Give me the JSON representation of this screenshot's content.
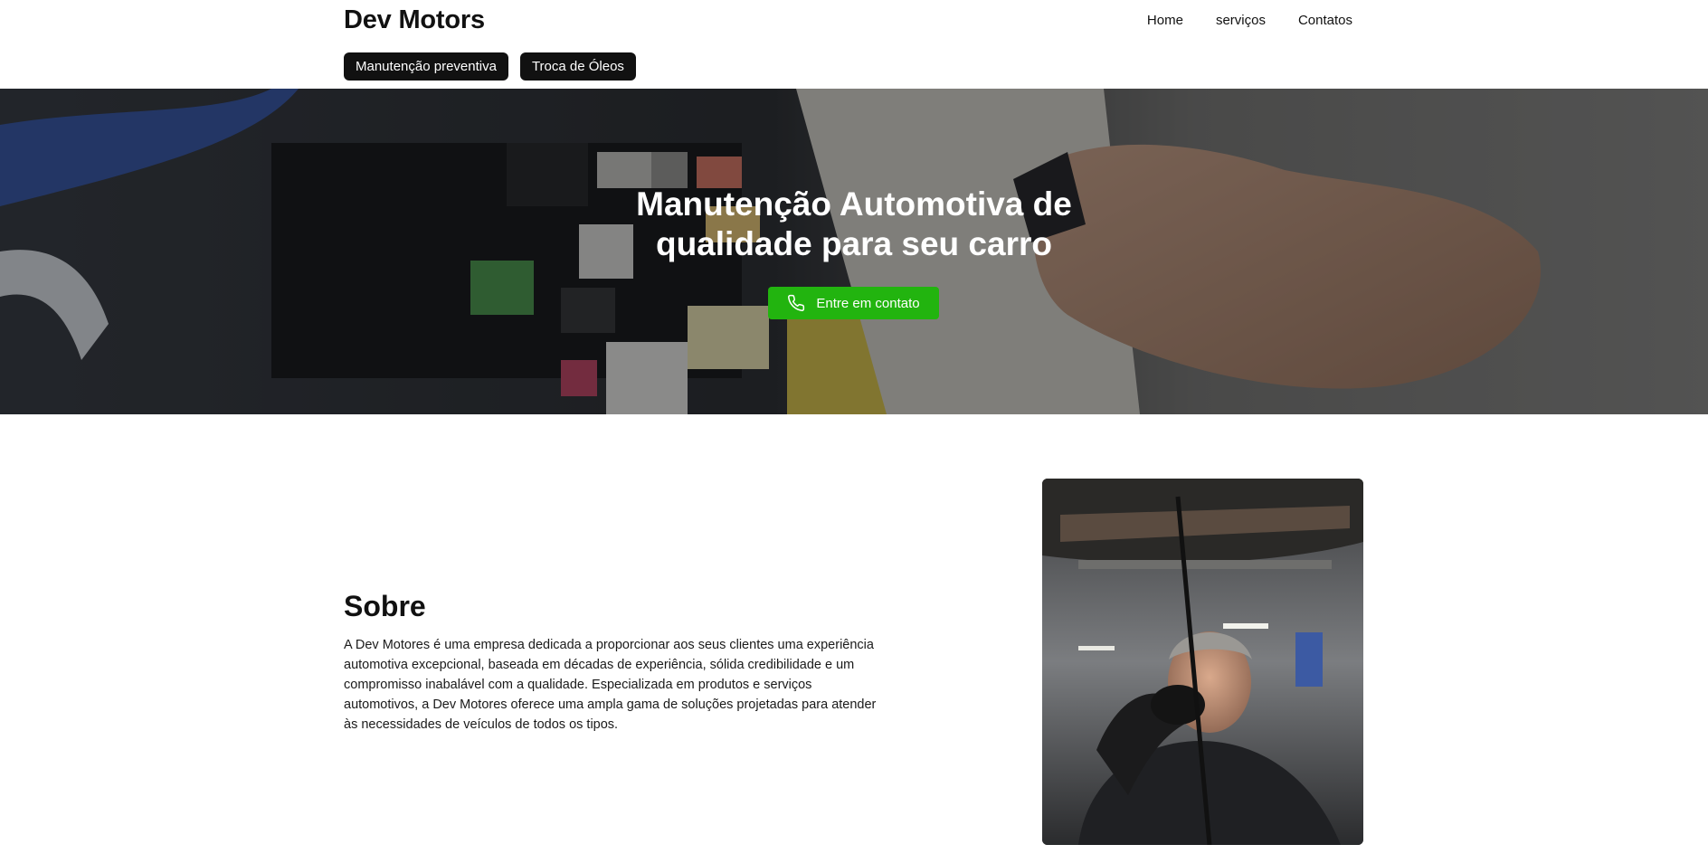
{
  "header": {
    "brand": "Dev Motors",
    "nav": [
      {
        "label": "Home"
      },
      {
        "label": "serviços"
      },
      {
        "label": "Contatos"
      }
    ],
    "chips": [
      {
        "label": "Manutenção preventiva"
      },
      {
        "label": "Troca de Óleos"
      }
    ]
  },
  "hero": {
    "title_line1": "Manutenção Automotiva de",
    "title_line2": "qualidade para seu carro",
    "cta_label": "Entre em contato",
    "cta_icon": "phone-icon",
    "cta_color": "#22b40f"
  },
  "about": {
    "title": "Sobre",
    "text": "A Dev Motores é uma empresa dedicada a proporcionar aos seus clientes uma experiência automotiva excepcional, baseada em décadas de experiência, sólida credibilidade e um compromisso inabalável com a qualidade. Especializada em produtos e serviços automotivos, a Dev Motores oferece uma ampla gama de soluções projetadas para atender às necessidades de veículos de todos os tipos."
  }
}
